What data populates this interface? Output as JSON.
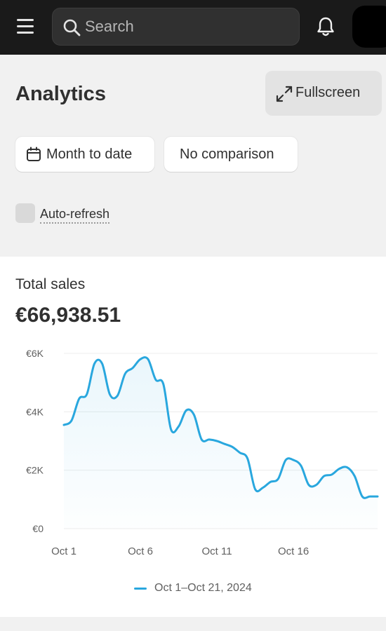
{
  "topbar": {
    "menu_icon": "hamburger-menu-icon",
    "search_placeholder": "Search",
    "search_icon": "search-icon",
    "bell_icon": "bell-icon",
    "avatar_icon": "avatar"
  },
  "header": {
    "title": "Analytics",
    "fullscreen_label": "Fullscreen",
    "fullscreen_icon": "expand-arrows-icon",
    "date_range_label": "Month to date",
    "date_range_icon": "calendar-icon",
    "comparison_label": "No comparison",
    "auto_refresh_label": "Auto-refresh",
    "auto_refresh_checked": false
  },
  "card": {
    "title": "Total sales",
    "value": "€66,938.51",
    "legend": "Oct 1–Oct 21, 2024"
  },
  "colors": {
    "topbar_bg": "#1a1a1a",
    "line": "#29a7de",
    "text": "#303030"
  },
  "chart_data": {
    "type": "area",
    "x_tick_labels": [
      "Oct 1",
      "Oct 6",
      "Oct 11",
      "Oct 16"
    ],
    "y_tick_labels": [
      "€0",
      "€2K",
      "€4K",
      "€6K"
    ],
    "ylim": [
      0,
      6000
    ],
    "grid": true,
    "series": [
      {
        "name": "Oct 1–Oct 21, 2024",
        "x": [
          1,
          1.5,
          2,
          2.5,
          3,
          3.5,
          4,
          4.5,
          5,
          5.5,
          6,
          6.5,
          7,
          7.5,
          8,
          8.5,
          9,
          9.5,
          10,
          10.5,
          11,
          11.5,
          12,
          12.5,
          13,
          13.5,
          14,
          14.5,
          15,
          15.5,
          16,
          16.5,
          17,
          17.5,
          18,
          18.5,
          19,
          19.5,
          20,
          20.5,
          21,
          21.5
        ],
        "values": [
          3550,
          3700,
          4450,
          4600,
          5650,
          5650,
          4600,
          4550,
          5300,
          5500,
          5800,
          5800,
          5100,
          4950,
          3400,
          3500,
          4050,
          3900,
          3050,
          3050,
          3000,
          2900,
          2800,
          2600,
          2400,
          1350,
          1400,
          1600,
          1700,
          2350,
          2350,
          2150,
          1500,
          1500,
          1800,
          1850,
          2050,
          2100,
          1800,
          1100,
          1100,
          1100
        ]
      }
    ]
  }
}
